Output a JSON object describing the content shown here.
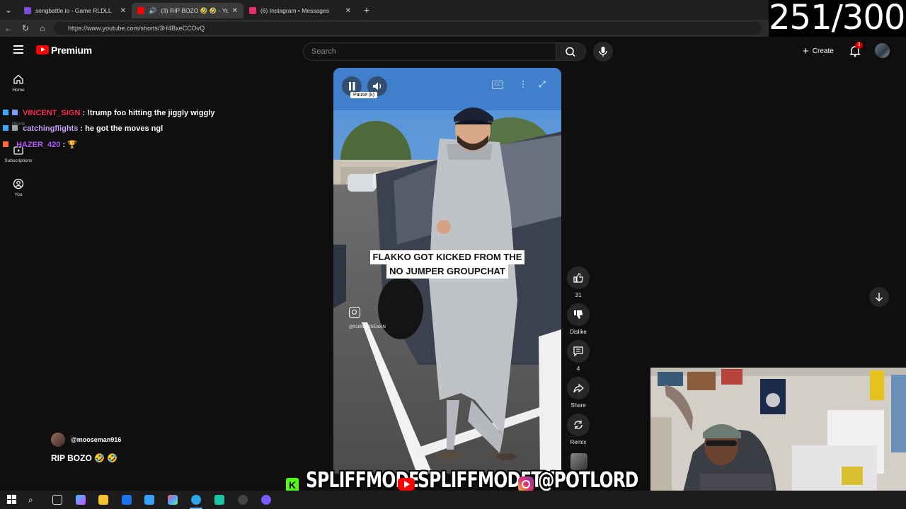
{
  "browser": {
    "tabs": [
      {
        "label": "songbattle.io - Game RLDLL",
        "active": false,
        "favicon_color": "#7b4dd6"
      },
      {
        "label": "(3) RIP BOZO 🤣 🤣 - YouTube",
        "active": true,
        "favicon_color": "#ff0000"
      },
      {
        "label": "(6) Instagram • Messages",
        "active": false,
        "favicon_color": "#e1306c"
      }
    ],
    "url": "https://www.youtube.com/shorts/3H4BxeCCOvQ"
  },
  "overlay_counter": "251/300",
  "youtube": {
    "logo_text": "Premium",
    "search_placeholder": "Search",
    "create_label": "Create",
    "notification_count": "3",
    "rail": [
      {
        "label": "Home",
        "icon": "home-icon"
      },
      {
        "label": "Shorts",
        "icon": "shorts-icon"
      },
      {
        "label": "Subscriptions",
        "icon": "subscriptions-icon"
      },
      {
        "label": "You",
        "icon": "you-icon"
      }
    ],
    "short": {
      "caption_line1": "FLAKKO GOT KICKED FROM THE",
      "caption_line2": "NO JUMPER GROUPCHAT",
      "watermark": "@916MOOSEMAN",
      "tooltip": "Pause (k)",
      "channel": "@mooseman916",
      "title": "RIP BOZO 🤣 🤣"
    },
    "actions": {
      "like_count": "31",
      "dislike_label": "Dislike",
      "comment_count": "4",
      "share_label": "Share",
      "remix_label": "Remix"
    }
  },
  "chat": [
    {
      "user": "VINCENT_SIGN",
      "text": ": !trump foo hitting the jiggly wiggly",
      "color": "#ff2d55"
    },
    {
      "user": "catchingflights",
      "text": ": he got the moves ngl",
      "color": "#c9a3ff"
    },
    {
      "user": "HAZER_420",
      "text": ": 🏆",
      "color": "#b65cff"
    }
  ],
  "stream_banner": {
    "handle1": "SPLIFFMODE",
    "handle2": "SPLIFFMODETV",
    "handle3": "@POTLORD"
  }
}
